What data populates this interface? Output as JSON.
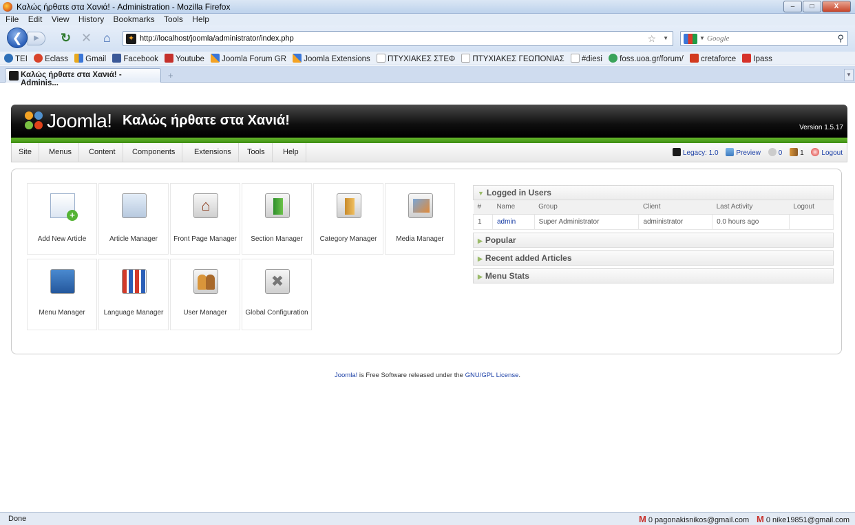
{
  "window": {
    "title": "Καλώς ήρθατε στα Χανιά! - Administration - Mozilla Firefox",
    "min_label": "–",
    "max_label": "□",
    "close_label": "X"
  },
  "menubar": [
    "File",
    "Edit",
    "View",
    "History",
    "Bookmarks",
    "Tools",
    "Help"
  ],
  "nav": {
    "url": "http://localhost/joomla/administrator/index.php",
    "search_placeholder": "Google"
  },
  "bookmarks": [
    {
      "label": "TEI",
      "color": "#2d6fb8"
    },
    {
      "label": "Eclass",
      "color": "#d8432a"
    },
    {
      "label": "Gmail",
      "color": "#e9a91d"
    },
    {
      "label": "Facebook",
      "color": "#3b5998"
    },
    {
      "label": "Youtube",
      "color": "#c4302b"
    },
    {
      "label": "Joomla Forum GR",
      "color": "#f4a324"
    },
    {
      "label": "Joomla Extensions",
      "color": "#f4a324"
    },
    {
      "label": "ΠΤΥΧΙΑΚΕΣ ΣΤΕΦ",
      "color": "#ffffff"
    },
    {
      "label": "ΠΤΥΧΙΑΚΕΣ ΓΕΩΠΟΝΙΑΣ",
      "color": "#ffffff"
    },
    {
      "label": "#diesi",
      "color": "#ffffff"
    },
    {
      "label": "foss.uoa.gr/forum/",
      "color": "#3aa35a"
    },
    {
      "label": "cretaforce",
      "color": "#d23a1f"
    },
    {
      "label": "Ipass",
      "color": "#d6322a"
    }
  ],
  "tab": {
    "title": "Καλώς ήρθατε στα Χανιά! - Adminis...",
    "close": "÷",
    "newtab": "+"
  },
  "joomla": {
    "logo_text": "Joomla!",
    "site_title": "Καλώς ήρθατε στα Χανιά!",
    "version": "Version 1.5.17",
    "menu": [
      "Site",
      "Menus",
      "Content",
      "Components",
      "Extensions",
      "Tools",
      "Help"
    ],
    "status": {
      "legacy": "Legacy: 1.0",
      "preview": "Preview",
      "messages": "0",
      "users": "1",
      "logout": "Logout"
    },
    "quickicons_row1": [
      "Add New Article",
      "Article Manager",
      "Front Page Manager",
      "Section Manager",
      "Category Manager",
      "Media Manager"
    ],
    "quickicons_row2": [
      "Menu Manager",
      "Language Manager",
      "User Manager",
      "Global Configuration"
    ],
    "panels": {
      "logged_in": "Logged in Users",
      "popular": "Popular",
      "recent": "Recent added Articles",
      "stats": "Menu Stats"
    },
    "users_table": {
      "headers": [
        "#",
        "Name",
        "Group",
        "Client",
        "Last Activity",
        "Logout"
      ],
      "rows": [
        [
          "1",
          "admin",
          "Super Administrator",
          "administrator",
          "0.0 hours ago",
          ""
        ]
      ]
    }
  },
  "footer": {
    "joomla_link": "Joomla!",
    "text": " is Free Software released under the ",
    "license_link": "GNU/GPL License",
    "end": "."
  },
  "statusbar": {
    "done": "Done",
    "mail1": "0 pagonakisnikos@gmail.com",
    "mail2": "0 nike19851@gmail.com"
  }
}
